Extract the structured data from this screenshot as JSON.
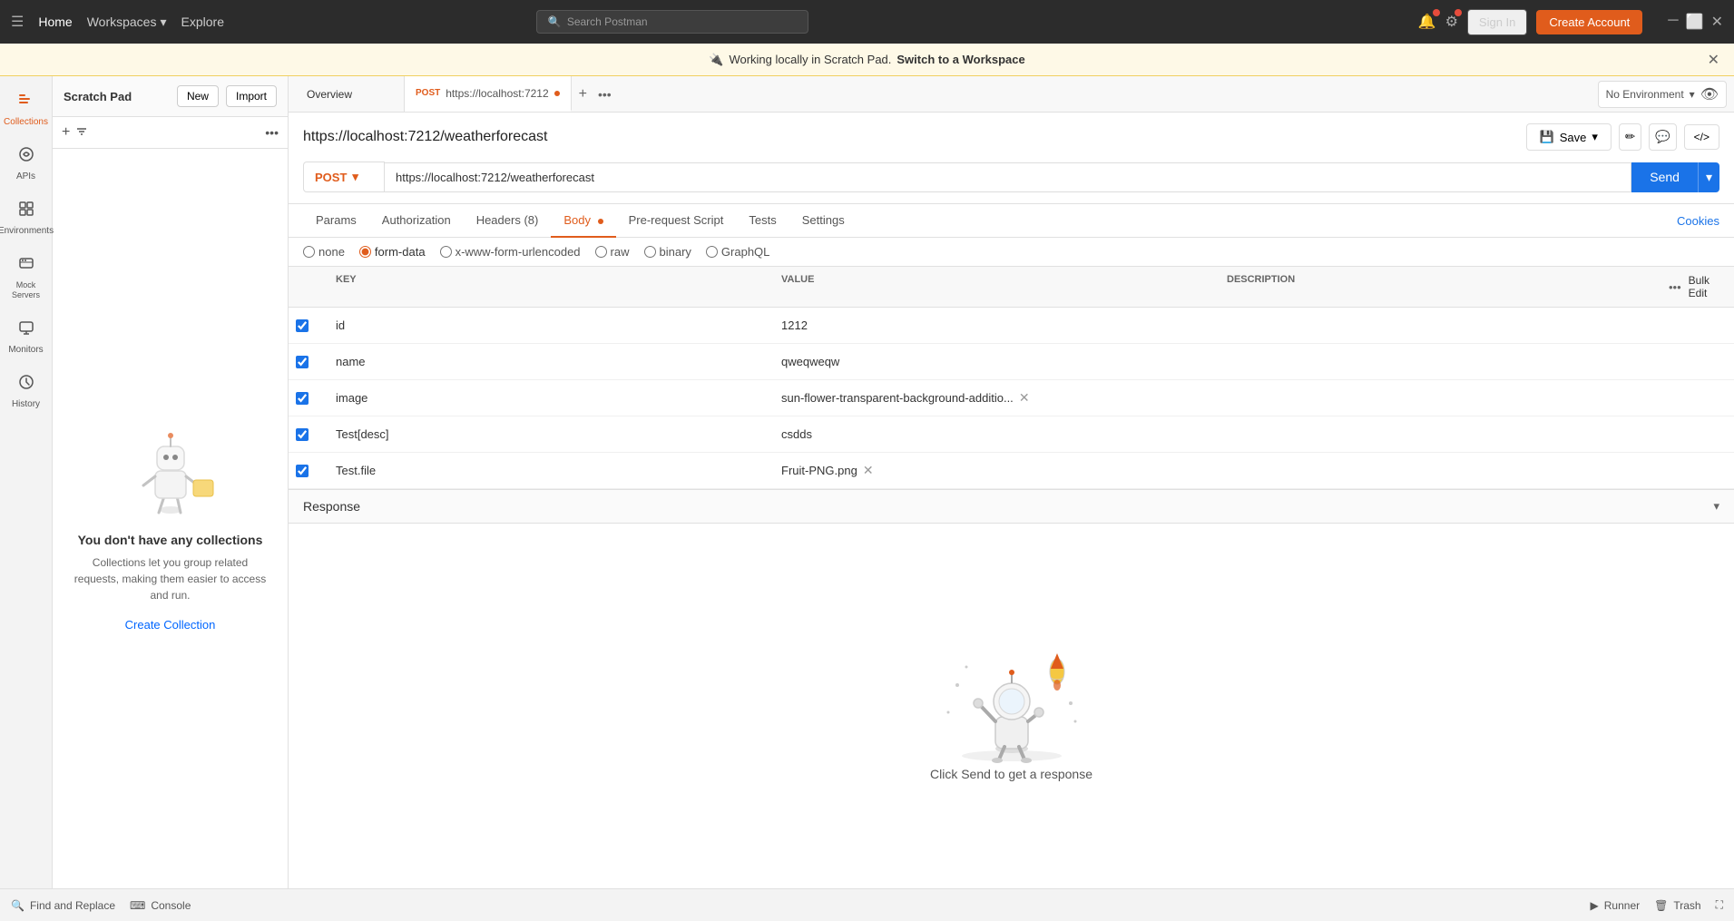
{
  "topNav": {
    "menuIcon": "☰",
    "home": "Home",
    "workspaces": "Workspaces",
    "workspacesChevron": "▾",
    "explore": "Explore",
    "searchPlaceholder": "Search Postman",
    "signIn": "Sign In",
    "createAccount": "Create Account"
  },
  "banner": {
    "icon": "🔌",
    "text": "Working locally in Scratch Pad.",
    "switchText": "Switch to a Workspace"
  },
  "scratchPad": {
    "title": "Scratch Pad",
    "newLabel": "New",
    "importLabel": "Import",
    "emptyTitle": "You don't have any collections",
    "emptyDesc": "Collections let you group related requests, making them easier to access and run.",
    "createLink": "Create Collection"
  },
  "sidebar": {
    "items": [
      {
        "id": "collections",
        "label": "Collections",
        "icon": "📁"
      },
      {
        "id": "apis",
        "label": "APIs",
        "icon": "⚙"
      },
      {
        "id": "environments",
        "label": "Environments",
        "icon": "🌐"
      },
      {
        "id": "mock-servers",
        "label": "Mock Servers",
        "icon": "🖥"
      },
      {
        "id": "monitors",
        "label": "Monitors",
        "icon": "📊"
      },
      {
        "id": "history",
        "label": "History",
        "icon": "🕐"
      }
    ]
  },
  "tabs": {
    "overview": "Overview",
    "activeTab": {
      "method": "POST",
      "url": "https://localhost:7212"
    },
    "noEnvironment": "No Environment"
  },
  "request": {
    "urlDisplay": "https://localhost:7212/weatherforecast",
    "method": "POST",
    "urlValue": "https://localhost:7212/weatherforecast",
    "saveLabel": "Save",
    "sendLabel": "Send"
  },
  "requestTabs": {
    "params": "Params",
    "authorization": "Authorization",
    "headers": "Headers",
    "headersCount": "(8)",
    "body": "Body",
    "preRequestScript": "Pre-request Script",
    "tests": "Tests",
    "settings": "Settings",
    "cookies": "Cookies"
  },
  "bodyOptions": {
    "none": "none",
    "formData": "form-data",
    "urlEncoded": "x-www-form-urlencoded",
    "raw": "raw",
    "binary": "binary",
    "graphql": "GraphQL"
  },
  "formTable": {
    "keyHeader": "KEY",
    "valueHeader": "VALUE",
    "descHeader": "DESCRIPTION",
    "bulkEdit": "Bulk Edit",
    "rows": [
      {
        "checked": true,
        "key": "id",
        "value": "1212",
        "desc": ""
      },
      {
        "checked": true,
        "key": "name",
        "value": "qweqweqw",
        "desc": ""
      },
      {
        "checked": true,
        "key": "image",
        "value": "sun-flower-transparent-background-additio...",
        "hasRemove": true,
        "desc": ""
      },
      {
        "checked": true,
        "key": "Test[desc]",
        "value": "csdds",
        "desc": ""
      },
      {
        "checked": true,
        "key": "Test.file",
        "value": "Fruit-PNG.png",
        "hasRemove": true,
        "desc": ""
      }
    ]
  },
  "response": {
    "title": "Response",
    "emptyMessage": "Click Send to get a response"
  },
  "bottomBar": {
    "findReplace": "Find and Replace",
    "console": "Console",
    "runner": "Runner",
    "trash": "Trash"
  }
}
